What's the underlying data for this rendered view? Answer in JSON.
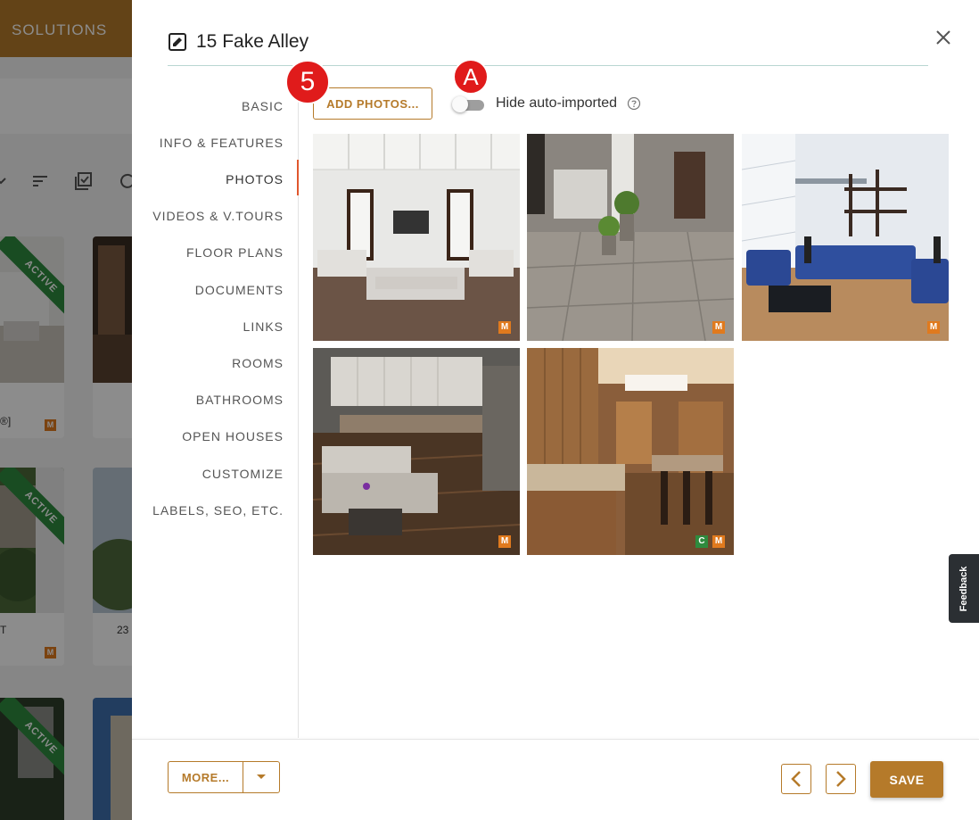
{
  "background": {
    "topbar_label": "SOLUTIONS",
    "ribbon_label": "ACTIVE",
    "card_texts": [
      "®]",
      "T",
      "23"
    ],
    "badge_letter": "M"
  },
  "modal": {
    "title": "15 Fake Alley",
    "nav": [
      {
        "label": "BASIC"
      },
      {
        "label": "INFO & FEATURES"
      },
      {
        "label": "PHOTOS"
      },
      {
        "label": "VIDEOS & V.TOURS"
      },
      {
        "label": "FLOOR PLANS"
      },
      {
        "label": "DOCUMENTS"
      },
      {
        "label": "LINKS"
      },
      {
        "label": "ROOMS"
      },
      {
        "label": "BATHROOMS"
      },
      {
        "label": "OPEN HOUSES"
      },
      {
        "label": "CUSTOMIZE"
      },
      {
        "label": "LABELS, SEO, ETC."
      }
    ],
    "active_nav": "PHOTOS",
    "add_photos_label": "ADD PHOTOS...",
    "step_badge": "5",
    "annotation_badge": "A",
    "toggle_label": "Hide auto-imported",
    "toggle_on": false,
    "photos": [
      {
        "badges": [
          "M"
        ]
      },
      {
        "badges": [
          "M"
        ]
      },
      {
        "badges": [
          "M"
        ]
      },
      {
        "badges": [
          "M"
        ]
      },
      {
        "badges": [
          "C",
          "M"
        ]
      }
    ],
    "footer": {
      "more_label": "MORE...",
      "save_label": "SAVE"
    },
    "feedback_label": "Feedback"
  },
  "colors": {
    "accent": "#b57a2a",
    "badge_red": "#e01b1b",
    "badge_m": "#e07a1e",
    "badge_c": "#2e8b3e",
    "active_indicator": "#e0572d"
  }
}
